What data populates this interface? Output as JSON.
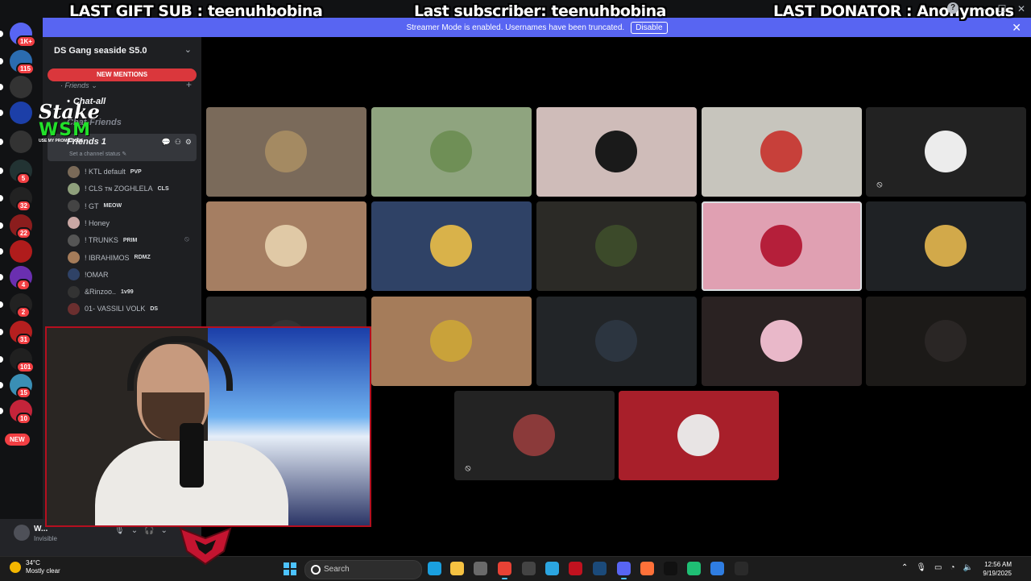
{
  "overlay": {
    "last_gift_sub": "LAST GIFT SUB : teenuhbobina",
    "last_subscriber": "Last subscriber: teenuhbobina",
    "last_donator": "LAST DONATOR : Anonymous"
  },
  "banner": {
    "text": "Streamer Mode is enabled. Usernames have been truncated.",
    "button": "Disable"
  },
  "rail": {
    "new_label": "NEW",
    "servers": [
      {
        "badge": "1K+",
        "color": "#5865f2"
      },
      {
        "badge": "115",
        "color": "#2b6cb0"
      },
      {
        "badge": "",
        "color": "#333"
      },
      {
        "badge": "",
        "color": "#1c3fa8"
      },
      {
        "badge": "",
        "color": "#333"
      },
      {
        "badge": "5",
        "color": "#233"
      },
      {
        "badge": "32",
        "color": "#222"
      },
      {
        "badge": "22",
        "color": "#8b1d1d"
      },
      {
        "badge": "",
        "color": "#b01c1c"
      },
      {
        "badge": "4",
        "color": "#6a2fb0"
      },
      {
        "badge": "2",
        "color": "#222"
      },
      {
        "badge": "31",
        "color": "#b51f1f"
      },
      {
        "badge": "101",
        "color": "#202020"
      },
      {
        "badge": "15",
        "color": "#3a8fb5"
      },
      {
        "badge": "10",
        "color": "#c4243a"
      }
    ]
  },
  "sidebar": {
    "guild_name": "DS Gang seaside S5.0",
    "new_mentions": "NEW MENTIONS",
    "category": "Friends",
    "channels": [
      {
        "name": "Chat-all",
        "dim": false
      },
      {
        "name": "Chat-Friends",
        "dim": true
      }
    ],
    "voice_channel": {
      "name": "Friends 1",
      "status": "Set a channel status"
    },
    "members": [
      {
        "name": "! KTL default",
        "tag": "PVP",
        "color": "#7a6a58",
        "muted": false
      },
      {
        "name": "! CLS ᴛɴ ZOGHLELA",
        "tag": "CLS",
        "color": "#8fa07c",
        "muted": false
      },
      {
        "name": "! GT",
        "tag": "MEOW",
        "color": "#444",
        "muted": false
      },
      {
        "name": "! Honey",
        "tag": "",
        "color": "#c9a7a4",
        "muted": false
      },
      {
        "name": "! TRUNKS",
        "tag": "PRIM",
        "color": "#555",
        "muted": true
      },
      {
        "name": "! IBRAHIMOS",
        "tag": "RDMZ",
        "color": "#a57c5a",
        "muted": false
      },
      {
        "name": "!OMAR",
        "tag": "",
        "color": "#2f4266",
        "muted": false
      },
      {
        "name": "&Rinzoo..",
        "tag": "1v99",
        "color": "#333",
        "muted": false
      },
      {
        "name": "01- VASSILI VOLK",
        "tag": "DS",
        "color": "#6b2f2f",
        "muted": false
      }
    ],
    "user": {
      "name": "W...",
      "status": "Invisible"
    }
  },
  "stage": {
    "tiles": [
      {
        "bg": "#7a6a5a",
        "avatar": "#a48a62",
        "muted": false,
        "speaking": false
      },
      {
        "bg": "#8fa47f",
        "avatar": "#6f8f56",
        "muted": false,
        "speaking": false
      },
      {
        "bg": "#cfbcb9",
        "avatar": "#1a1a1a",
        "muted": false,
        "speaking": false
      },
      {
        "bg": "#c7c5bd",
        "avatar": "#c7403a",
        "muted": false,
        "speaking": false
      },
      {
        "bg": "#222222",
        "avatar": "#ececec",
        "muted": true,
        "speaking": false
      },
      {
        "bg": "#a57e62",
        "avatar": "#e0c9a6",
        "muted": false,
        "speaking": false
      },
      {
        "bg": "#2f4266",
        "avatar": "#d9b24a",
        "muted": false,
        "speaking": false
      },
      {
        "bg": "#2b2a26",
        "avatar": "#3c4a2a",
        "muted": false,
        "speaking": false
      },
      {
        "bg": "#e0a0b2",
        "avatar": "#b51f3a",
        "muted": false,
        "speaking": true
      },
      {
        "bg": "#1f2225",
        "avatar": "#d2a94a",
        "muted": false,
        "speaking": false
      },
      {
        "bg": "#2a2a2a",
        "avatar": "#333333",
        "muted": false,
        "speaking": false
      },
      {
        "bg": "#a57c5a",
        "avatar": "#c9a23a",
        "muted": false,
        "speaking": false
      },
      {
        "bg": "#222528",
        "avatar": "#2c3540",
        "muted": false,
        "speaking": false
      },
      {
        "bg": "#2a2222",
        "avatar": "#e9b8c9",
        "muted": false,
        "speaking": false
      },
      {
        "bg": "#1c1a18",
        "avatar": "#2a2625",
        "muted": false,
        "speaking": false
      },
      {
        "bg": "#232323",
        "avatar": "#8b3a3a",
        "muted": true,
        "speaking": false
      },
      {
        "bg": "#a81f2a",
        "avatar": "#e8e4e4",
        "muted": false,
        "speaking": false
      }
    ]
  },
  "stake": {
    "line1": "Stake",
    "line2": "WSM",
    "line3": "USE MY PROMO CODE"
  },
  "taskbar": {
    "temp": "34°C",
    "condition": "Mostly clear",
    "search": "Search",
    "time": "12:56 AM",
    "date": "9/19/2025",
    "apps": [
      {
        "name": "edge-icon",
        "color": "#1aa0e0"
      },
      {
        "name": "file-explorer-icon",
        "color": "#f5c242"
      },
      {
        "name": "store-icon",
        "color": "#6a6a6a"
      },
      {
        "name": "chrome-icon",
        "color": "#e84235",
        "active": true
      },
      {
        "name": "obs-icon",
        "color": "#444"
      },
      {
        "name": "telegram-icon",
        "color": "#2ba5e0"
      },
      {
        "name": "opera-icon",
        "color": "#c1121f"
      },
      {
        "name": "steam-icon",
        "color": "#1b4a7a"
      },
      {
        "name": "discord-icon",
        "color": "#5865f2",
        "active": true
      },
      {
        "name": "firefox-icon",
        "color": "#ff7139"
      },
      {
        "name": "capcut-icon",
        "color": "#111"
      },
      {
        "name": "app-green-icon",
        "color": "#1fbf74"
      },
      {
        "name": "app-blue-icon",
        "color": "#2f7de1"
      },
      {
        "name": "epic-games-icon",
        "color": "#2a2a2a"
      }
    ]
  }
}
